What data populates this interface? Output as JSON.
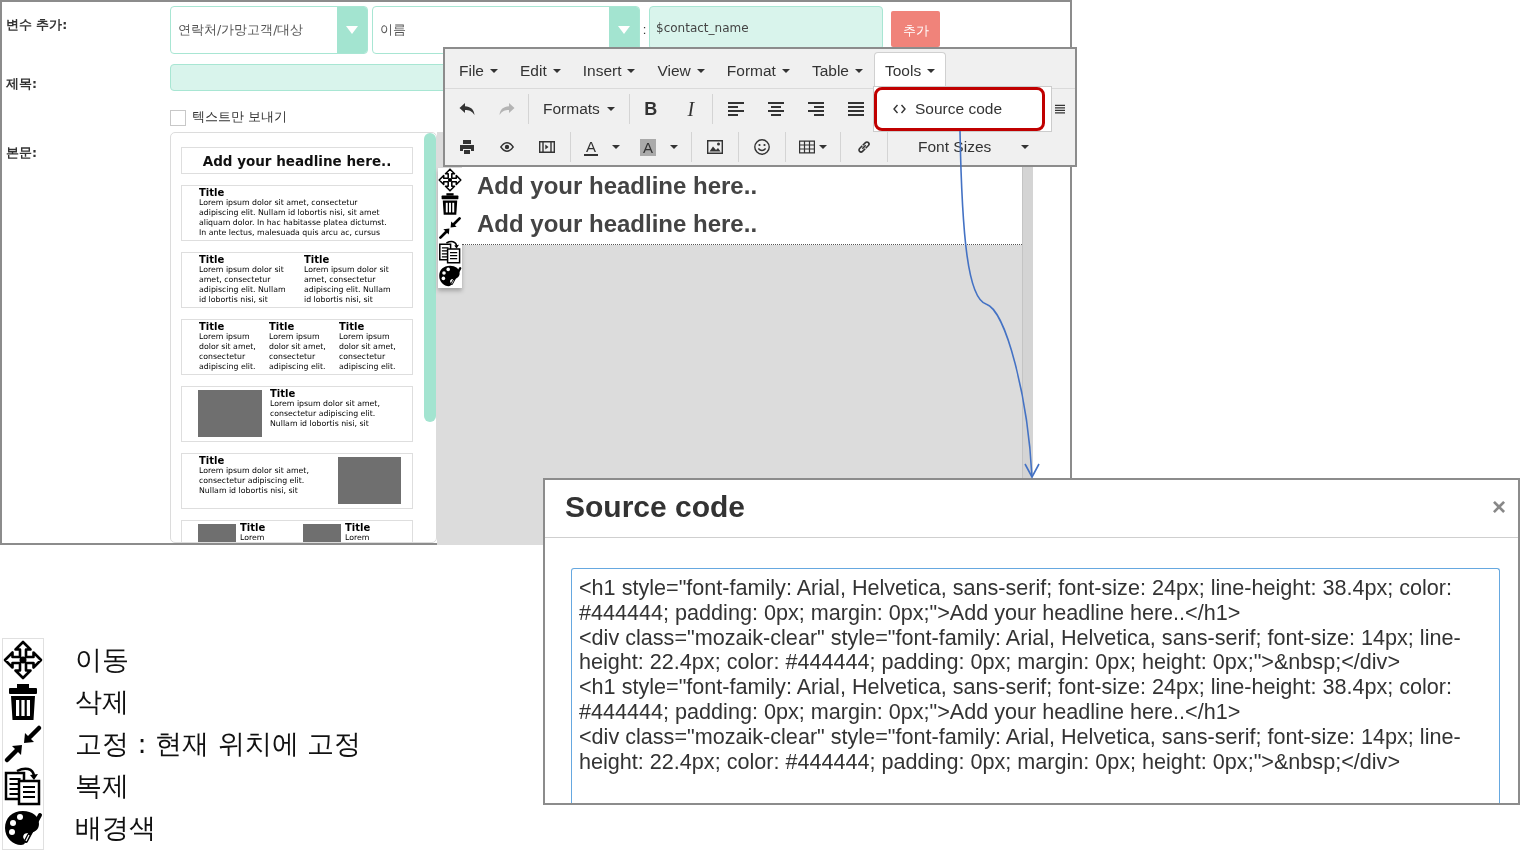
{
  "variable_row": {
    "label": "변수 추가:",
    "category_select": "연락처/가망고객/대상",
    "field_select": "이름",
    "separator": ":",
    "variable_field": "$contact_name",
    "add_button": "추가"
  },
  "subject_row": {
    "label": "제목:"
  },
  "text_only_option": {
    "label": "텍스트만 보내기",
    "checked": false
  },
  "body_row": {
    "label": "본문:"
  },
  "template_list": [
    {
      "kind": "headline",
      "text": "Add your headline here.."
    },
    {
      "kind": "columns",
      "columns": [
        {
          "title": "Title",
          "lines": [
            "Lorem ipsum dolor sit amet, consectetur",
            "adipiscing elit. Nullam id lobortis nisi, sit amet",
            "aliquam dolor. In hac habitasse platea dictumst.",
            "In ante lectus, malesuada quis arcu ac, cursus"
          ]
        }
      ]
    },
    {
      "kind": "columns",
      "columns": [
        {
          "title": "Title",
          "lines": [
            "Lorem ipsum dolor sit",
            "amet, consectetur",
            "adipiscing elit. Nullam",
            "id lobortis nisi, sit"
          ]
        },
        {
          "title": "Title",
          "lines": [
            "Lorem ipsum dolor sit",
            "amet, consectetur",
            "adipiscing elit. Nullam",
            "id lobortis nisi, sit"
          ]
        }
      ]
    },
    {
      "kind": "columns",
      "columns": [
        {
          "title": "Title",
          "lines": [
            "Lorem ipsum",
            "dolor sit amet,",
            "consectetur",
            "adipiscing elit."
          ]
        },
        {
          "title": "Title",
          "lines": [
            "Lorem ipsum",
            "dolor sit amet,",
            "consectetur",
            "adipiscing elit."
          ]
        },
        {
          "title": "Title",
          "lines": [
            "Lorem ipsum",
            "dolor sit amet,",
            "consectetur",
            "adipiscing elit."
          ]
        }
      ]
    },
    {
      "kind": "image_left",
      "columns": [
        {
          "title": "Title",
          "lines": [
            "Lorem ipsum dolor sit amet,",
            "consectetur adipiscing elit.",
            "Nullam id lobortis nisi, sit"
          ]
        }
      ]
    },
    {
      "kind": "image_right",
      "columns": [
        {
          "title": "Title",
          "lines": [
            "Lorem ipsum dolor sit amet,",
            "consectetur adipiscing elit.",
            "Nullam id lobortis nisi, sit"
          ]
        }
      ]
    },
    {
      "kind": "image_columns",
      "columns": [
        {
          "title": "Title",
          "lines": [
            "Lorem"
          ]
        },
        {
          "title": "Title",
          "lines": [
            "Lorem"
          ]
        }
      ]
    }
  ],
  "editor_toolbar": {
    "menus": [
      {
        "label": "File",
        "selected": false
      },
      {
        "label": "Edit",
        "selected": false
      },
      {
        "label": "Insert",
        "selected": false
      },
      {
        "label": "View",
        "selected": false
      },
      {
        "label": "Format",
        "selected": false
      },
      {
        "label": "Table",
        "selected": false
      },
      {
        "label": "Tools",
        "selected": true
      }
    ],
    "rows": [
      [
        [
          {
            "kind": "undo",
            "disabled": false
          },
          {
            "kind": "redo",
            "disabled": true
          }
        ],
        [
          {
            "kind": "formats",
            "label": "Formats",
            "disabled": false
          }
        ],
        [
          {
            "kind": "bold",
            "label": "B",
            "disabled": false
          },
          {
            "kind": "italic",
            "label": "I",
            "disabled": false
          }
        ],
        [
          {
            "kind": "align_left",
            "disabled": false
          },
          {
            "kind": "align_center",
            "disabled": false
          },
          {
            "kind": "align_right",
            "disabled": false
          },
          {
            "kind": "justify",
            "disabled": false
          }
        ],
        [
          {
            "kind": "list",
            "disabled": false
          }
        ]
      ],
      [
        [
          {
            "kind": "print",
            "disabled": false
          },
          {
            "kind": "preview",
            "disabled": false
          },
          {
            "kind": "media",
            "disabled": false
          }
        ],
        [
          {
            "kind": "text_color",
            "label": "A",
            "disabled": false
          },
          {
            "kind": "background_color",
            "label": "A",
            "disabled": false
          }
        ],
        [
          {
            "kind": "image",
            "disabled": false
          }
        ],
        [
          {
            "kind": "emoji",
            "disabled": false
          }
        ],
        [
          {
            "kind": "table",
            "disabled": false
          }
        ],
        [
          {
            "kind": "link",
            "disabled": false
          }
        ],
        [
          {
            "kind": "font_sizes",
            "label": "Font Sizes",
            "disabled": false
          }
        ]
      ]
    ],
    "tools_menu": [
      {
        "label": "Source code"
      }
    ]
  },
  "editor": {
    "blocks": [
      "Add your headline here..",
      "Add your headline here.."
    ]
  },
  "source_dialog": {
    "title": "Source code",
    "close": "×",
    "lines": [
      "<h1 style=\"font-family: Arial, Helvetica, sans-serif; font-size: 24px; line-height: 38.4px; color: #444444; padding: 0px; margin: 0px;\">Add your headline here..</h1>",
      "<div class=\"mozaik-clear\" style=\"font-family: Arial, Helvetica, sans-serif; font-size: 14px; line-height: 22.4px; color: #444444; padding: 0px; margin: 0px; height: 0px;\">&nbsp;</div>",
      "<h1 style=\"font-family: Arial, Helvetica, sans-serif; font-size: 24px; line-height: 38.4px; color: #444444; padding: 0px; margin: 0px;\">Add your headline here..</h1>",
      "<div class=\"mozaik-clear\" style=\"font-family: Arial, Helvetica, sans-serif; font-size: 14px; line-height: 22.4px; color: #444444; padding: 0px; margin: 0px; height: 0px;\">&nbsp;</div>"
    ]
  },
  "legend": [
    {
      "kind": "move",
      "label": "이동"
    },
    {
      "kind": "delete",
      "label": "삭제"
    },
    {
      "kind": "pin",
      "label": "고정 : 현재 위치에 고정"
    },
    {
      "kind": "duplicate",
      "label": "복제"
    },
    {
      "kind": "palette",
      "label": "배경색"
    }
  ]
}
